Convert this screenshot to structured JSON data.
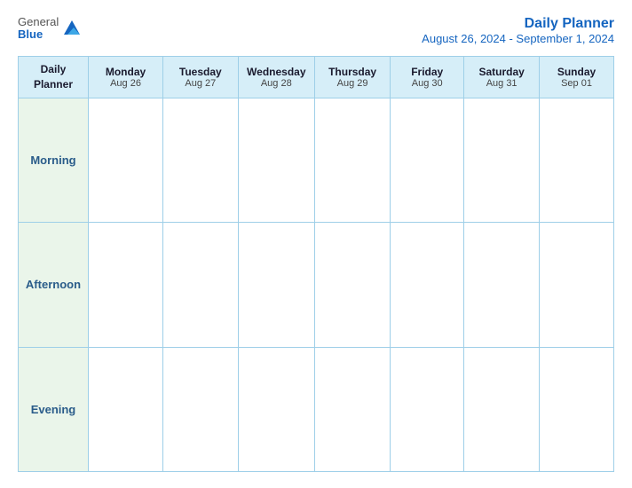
{
  "logo": {
    "general": "General",
    "blue": "Blue"
  },
  "header": {
    "title": "Daily Planner",
    "dateRange": "August 26, 2024 - September 1, 2024"
  },
  "table": {
    "topLeft": {
      "line1": "Daily",
      "line2": "Planner"
    },
    "columns": [
      {
        "day": "Monday",
        "date": "Aug 26"
      },
      {
        "day": "Tuesday",
        "date": "Aug 27"
      },
      {
        "day": "Wednesday",
        "date": "Aug 28"
      },
      {
        "day": "Thursday",
        "date": "Aug 29"
      },
      {
        "day": "Friday",
        "date": "Aug 30"
      },
      {
        "day": "Saturday",
        "date": "Aug 31"
      },
      {
        "day": "Sunday",
        "date": "Sep 01"
      }
    ],
    "rows": [
      {
        "label": "Morning"
      },
      {
        "label": "Afternoon"
      },
      {
        "label": "Evening"
      }
    ]
  }
}
